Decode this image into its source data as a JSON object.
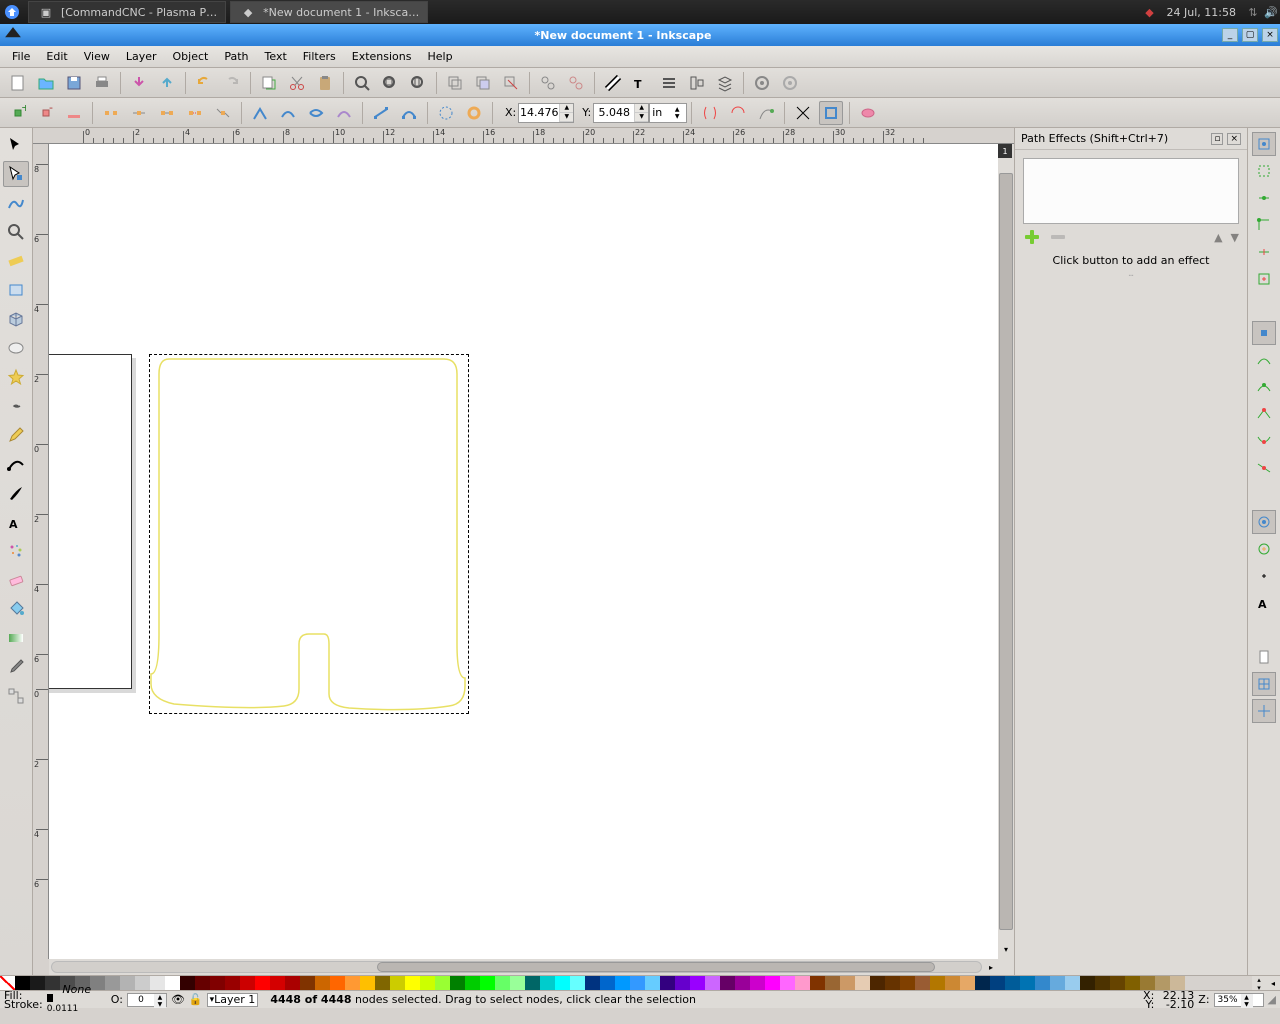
{
  "desktop": {
    "task1": "[CommandCNC - Plasma P…",
    "task2": "*New document 1 - Inksca…",
    "clock": "24 Jul, 11:58"
  },
  "window": {
    "title": "*New document 1 - Inkscape"
  },
  "menus": [
    "File",
    "Edit",
    "View",
    "Layer",
    "Object",
    "Path",
    "Text",
    "Filters",
    "Extensions",
    "Help"
  ],
  "coords": {
    "xlabel": "X:",
    "x": "14.476",
    "ylabel": "Y:",
    "y": "5.048",
    "unit": "in"
  },
  "dock": {
    "title": "Path Effects  (Shift+Ctrl+7)",
    "hint": "Click button to add an effect"
  },
  "status": {
    "fill_label": "Fill:",
    "fill_value": "None",
    "stroke_label": "Stroke:",
    "stroke_value": "0.0111",
    "opacity_label": "O:",
    "opacity": "0",
    "layer": "Layer 1",
    "selnodes": "4448 of 4448",
    "msg": " nodes selected. Drag to select nodes, click clear the selection",
    "sx_label": "X:",
    "sy_label": "Y:",
    "sx": "22.13",
    "sy": "-2.10",
    "zlabel": "Z:",
    "zoom": "35%"
  },
  "ruler_h": [
    {
      "pos": 50,
      "label": "0"
    },
    {
      "pos": 100,
      "label": "2"
    },
    {
      "pos": 150,
      "label": "4"
    },
    {
      "pos": 200,
      "label": "6"
    },
    {
      "pos": 250,
      "label": "8"
    },
    {
      "pos": 300,
      "label": "10"
    },
    {
      "pos": 350,
      "label": "12"
    },
    {
      "pos": 400,
      "label": "14"
    },
    {
      "pos": 450,
      "label": "16"
    },
    {
      "pos": 500,
      "label": "18"
    },
    {
      "pos": 550,
      "label": "20"
    },
    {
      "pos": 600,
      "label": "22"
    },
    {
      "pos": 650,
      "label": "24"
    },
    {
      "pos": 700,
      "label": "26"
    },
    {
      "pos": 750,
      "label": "28"
    },
    {
      "pos": 800,
      "label": "30"
    },
    {
      "pos": 850,
      "label": "32"
    }
  ],
  "ruler_v": [
    {
      "pos": 20,
      "label": "8"
    },
    {
      "pos": 90,
      "label": "6"
    },
    {
      "pos": 160,
      "label": "4"
    },
    {
      "pos": 230,
      "label": "2"
    },
    {
      "pos": 300,
      "label": "0"
    },
    {
      "pos": 370,
      "label": "2"
    },
    {
      "pos": 440,
      "label": "4"
    },
    {
      "pos": 510,
      "label": "6"
    },
    {
      "pos": 545,
      "label": "0"
    },
    {
      "pos": 615,
      "label": "2"
    },
    {
      "pos": 685,
      "label": "4"
    },
    {
      "pos": 735,
      "label": "6"
    }
  ],
  "palette_colors": [
    "#000000",
    "#1a1a1a",
    "#333333",
    "#4d4d4d",
    "#666666",
    "#808080",
    "#999999",
    "#b3b3b3",
    "#cccccc",
    "#e6e6e6",
    "#ffffff",
    "#330000",
    "#660000",
    "#800000",
    "#990000",
    "#cc0000",
    "#ff0000",
    "#d40000",
    "#aa0000",
    "#803300",
    "#cc6600",
    "#ff6600",
    "#ff9933",
    "#ffbf00",
    "#806600",
    "#cccc00",
    "#ffff00",
    "#ccff00",
    "#99ff33",
    "#008000",
    "#00cc00",
    "#00ff00",
    "#66ff66",
    "#99ff99",
    "#006666",
    "#00cccc",
    "#00ffff",
    "#66ffff",
    "#003380",
    "#0066cc",
    "#0099ff",
    "#3399ff",
    "#66ccff",
    "#330080",
    "#6600cc",
    "#9900ff",
    "#cc66ff",
    "#660066",
    "#990099",
    "#cc00cc",
    "#ff00ff",
    "#ff66ff",
    "#ff99cc",
    "#803300",
    "#996633",
    "#cc9966",
    "#e6ccb3",
    "#4d2600",
    "#663300",
    "#804000",
    "#995c33",
    "#b37700",
    "#cc8833",
    "#e6a866",
    "#00264d",
    "#004080",
    "#005c99",
    "#0073b3",
    "#3388cc",
    "#66aadd",
    "#99ccee",
    "#332100",
    "#4d3300",
    "#664400",
    "#806000",
    "#997a33",
    "#b39966",
    "#ccb899"
  ]
}
